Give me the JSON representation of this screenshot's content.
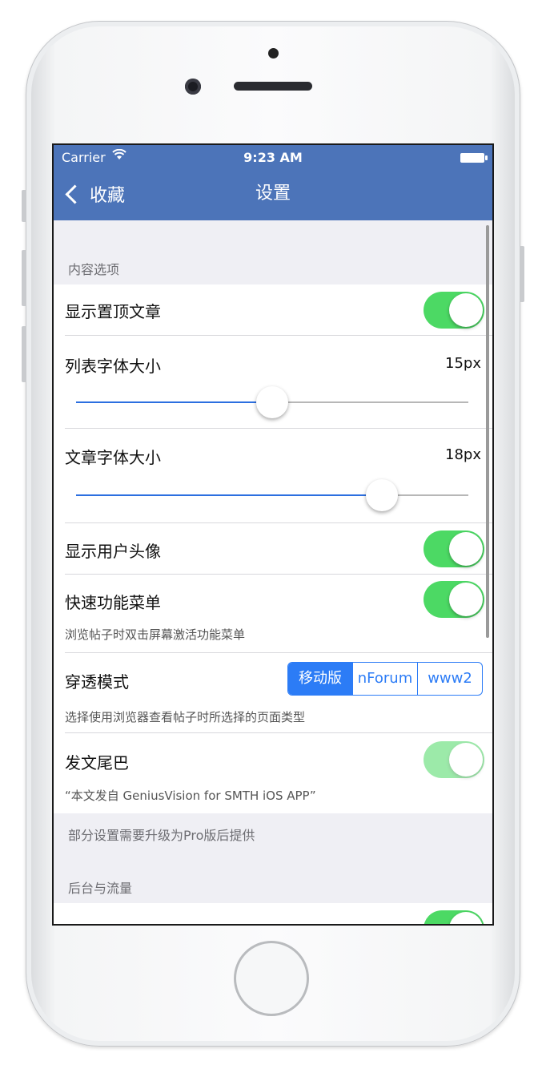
{
  "status_bar": {
    "carrier": "Carrier",
    "time": "9:23 AM"
  },
  "nav": {
    "back_label": "收藏",
    "title": "设置"
  },
  "sections": {
    "content": {
      "header": "内容选项"
    },
    "background": {
      "header": "后台与流量"
    }
  },
  "settings": {
    "show_pinned": {
      "label": "显示置顶文章",
      "on": true
    },
    "list_font": {
      "label": "列表字体大小",
      "value": "15px",
      "level": 0.5
    },
    "article_font": {
      "label": "文章字体大小",
      "value": "18px",
      "level": 0.78
    },
    "show_avatar": {
      "label": "显示用户头像",
      "on": true
    },
    "quick_menu": {
      "label": "快速功能菜单",
      "note": "浏览帖子时双击屏幕激活功能菜单",
      "on": true
    },
    "pass_mode": {
      "label": "穿透模式",
      "note": "选择使用浏览器查看帖子时所选择的页面类型",
      "options": [
        "移动版",
        "nForum",
        "www2"
      ],
      "selected": "移动版"
    },
    "signature": {
      "label": "发文尾巴",
      "note": "“本文发自 GeniusVision for SMTH iOS APP”",
      "on": true,
      "enabled": false
    }
  },
  "footer_note": "部分设置需要升级为Pro版后提供",
  "colors": {
    "nav": "#4c74b9",
    "toggle_on": "#4cd964",
    "accent": "#2c7cf6"
  }
}
